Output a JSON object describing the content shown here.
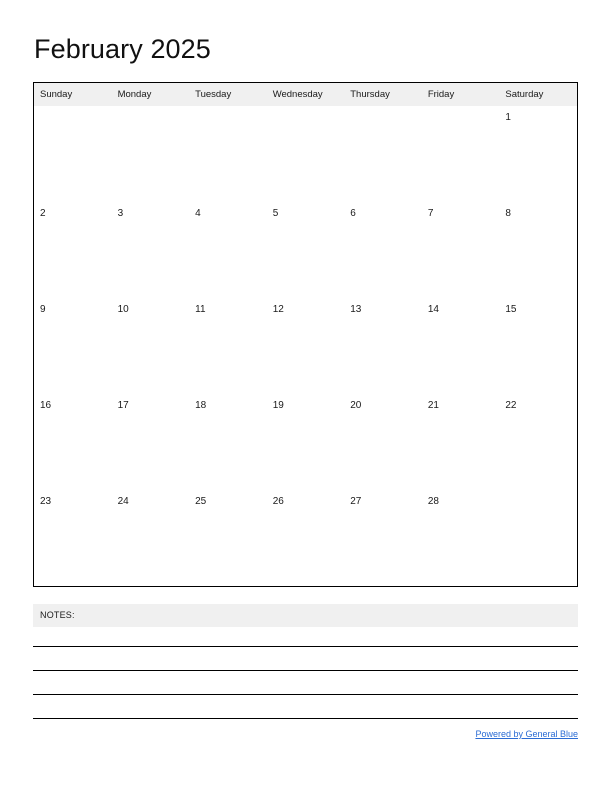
{
  "document": {
    "title": "February 2025"
  },
  "calendar": {
    "month_label": "February 2025",
    "weekday_headers": [
      "Sunday",
      "Monday",
      "Tuesday",
      "Wednesday",
      "Thursday",
      "Friday",
      "Saturday"
    ],
    "weeks": [
      [
        "",
        "",
        "",
        "",
        "",
        "",
        "1"
      ],
      [
        "2",
        "3",
        "4",
        "5",
        "6",
        "7",
        "8"
      ],
      [
        "9",
        "10",
        "11",
        "12",
        "13",
        "14",
        "15"
      ],
      [
        "16",
        "17",
        "18",
        "19",
        "20",
        "21",
        "22"
      ],
      [
        "23",
        "24",
        "25",
        "26",
        "27",
        "28",
        ""
      ]
    ]
  },
  "notes": {
    "label": "NOTES:",
    "line_count": 4
  },
  "footer": {
    "link_text": "Powered by General Blue"
  },
  "colors": {
    "header_band": "#f0f0f0",
    "border": "#000000",
    "text": "#1a1a1a",
    "link": "#2b6cd4",
    "page_background": "#ffffff"
  }
}
